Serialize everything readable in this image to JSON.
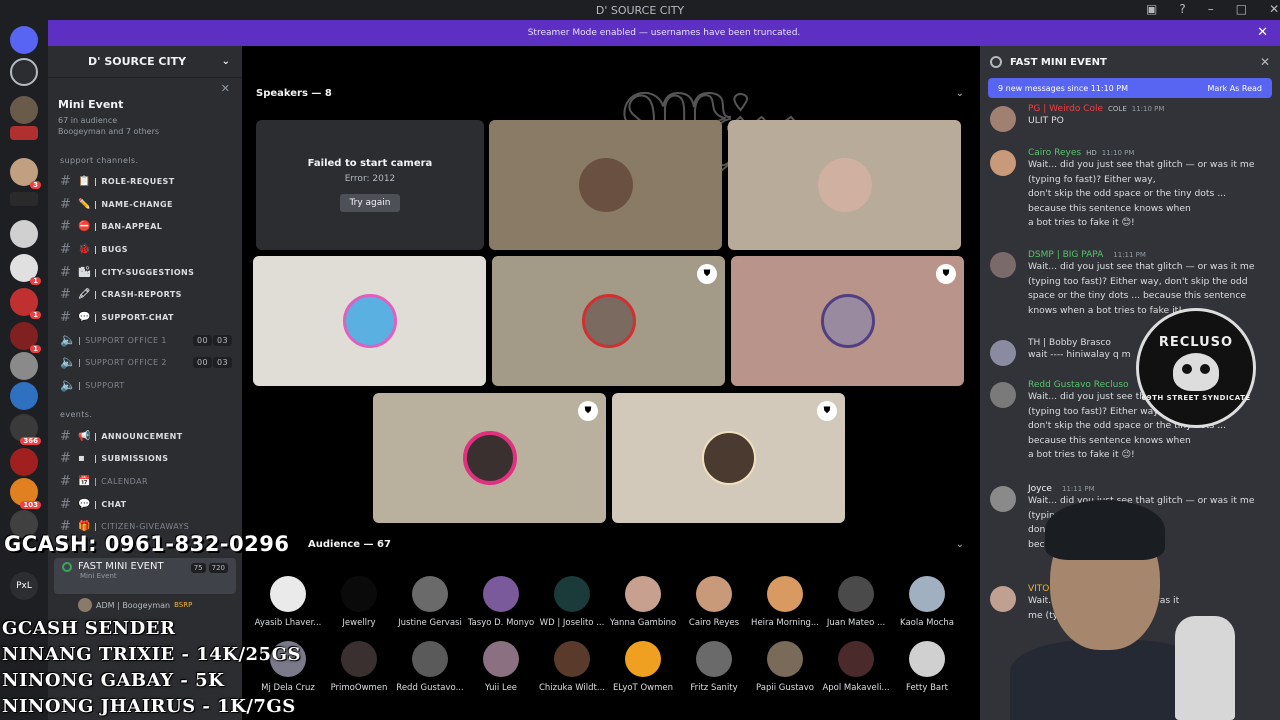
{
  "window": {
    "title": "D' SOURCE CITY"
  },
  "banner": {
    "text": "Streamer Mode enabled — usernames have been truncated."
  },
  "server": {
    "name": "D' SOURCE CITY"
  },
  "stage_card": {
    "title": "Mini Event",
    "audience": "67 in audience",
    "speakers": "Boogeyman and 7 others"
  },
  "categories": {
    "support": "support channels.",
    "events": "events."
  },
  "channels": [
    {
      "name": "ROLE-REQUEST",
      "emoji": "📋"
    },
    {
      "name": "NAME-CHANGE",
      "emoji": "✏️"
    },
    {
      "name": "BAN-APPEAL",
      "emoji": "⛔"
    },
    {
      "name": "BUGS",
      "emoji": "🐞"
    },
    {
      "name": "CITY-SUGGESTIONS",
      "emoji": "🏙"
    },
    {
      "name": "CRASH-REPORTS",
      "emoji": "🖍"
    },
    {
      "name": "SUPPORT-CHAT",
      "emoji": "💬"
    }
  ],
  "voice_channels": [
    {
      "name": "SUPPORT OFFICE 1",
      "c1": "00",
      "c2": "03"
    },
    {
      "name": "SUPPORT OFFICE 2",
      "c1": "00",
      "c2": "03"
    },
    {
      "name": "SUPPORT"
    }
  ],
  "event_channels": [
    {
      "name": "ANNOUNCEMENT",
      "emoji": "📢",
      "muted": false
    },
    {
      "name": "SUBMISSIONS",
      "emoji": "▪",
      "muted": false
    },
    {
      "name": "CALENDAR",
      "emoji": "📅",
      "muted": true
    },
    {
      "name": "CHAT",
      "emoji": "💬",
      "muted": false
    },
    {
      "name": "CITIZEN-GIVEAWAYS",
      "emoji": "🎁",
      "muted": true
    }
  ],
  "active_voice": {
    "name": "FAST MINI EVENT",
    "sub": "Mini Event",
    "count1": "75",
    "count2": "720",
    "user": "ADM | Boogeyman",
    "user_tag": "BSRP"
  },
  "stage": {
    "speakers_label": "Speakers — 8",
    "audience_label": "Audience — 67",
    "camera_error": "Failed to start camera",
    "error_code": "Error: 2012",
    "try_again": "Try again"
  },
  "audience": [
    {
      "name": "Ayasib Lhaver...",
      "color": "#eaeaea"
    },
    {
      "name": "Jewellry",
      "color": "#0a0a0a"
    },
    {
      "name": "Justine Gervasi",
      "color": "#6a6a6a"
    },
    {
      "name": "Tasyo D. Monyo",
      "color": "#7a5a9a"
    },
    {
      "name": "WD | Joselito ...",
      "color": "#1b3a3a"
    },
    {
      "name": "Yanna Gambino",
      "color": "#c8a090"
    },
    {
      "name": "Cairo Reyes",
      "color": "#c89a7a"
    },
    {
      "name": "Heira Morning...",
      "color": "#d89a60"
    },
    {
      "name": "Juan Mateo ...",
      "color": "#4a4a4a"
    },
    {
      "name": "Kaola Mocha",
      "color": "#a0b0c0"
    },
    {
      "name": "Mj Dela Cruz",
      "color": "#7a7a8a"
    },
    {
      "name": "PrimoOwmen",
      "color": "#3a3030"
    },
    {
      "name": "Redd Gustavo...",
      "color": "#5a5a5a"
    },
    {
      "name": "Yuii Lee",
      "color": "#8a7080"
    },
    {
      "name": "Chizuka Wildt...",
      "color": "#5a3a2a"
    },
    {
      "name": "ELyoT Owmen",
      "color": "#f0a020"
    },
    {
      "name": "Fritz Sanity",
      "color": "#6a6a6a"
    },
    {
      "name": "Papii Gustavo",
      "color": "#7a6a5a"
    },
    {
      "name": "Apol Makaveli...",
      "color": "#4a2a2a"
    },
    {
      "name": "Fetty Bart",
      "color": "#d0d0d0"
    }
  ],
  "chat": {
    "title": "FAST MINI EVENT",
    "new_messages": "9 new messages since 11:10 PM",
    "mark_read": "Mark As Read"
  },
  "messages": [
    {
      "author": "PG | Weirdo Cole",
      "tag": "COLE",
      "time": "11:10 PM",
      "color": "#f23f43",
      "body": "ULIT PO",
      "avatar": "#a08070"
    },
    {
      "author": "Cairo Reyes",
      "tag": "HD",
      "time": "11:10 PM",
      "color": "#57c36b",
      "body": "Wait... did you just see that glitch — or was it me\n(typing fo fast)? Either way,\ndon't skip the odd space or the tiny dots ...\nbecause this sentence knows when\na bot tries to fake it 😊!",
      "avatar": "#c89a7a"
    },
    {
      "author": "DSMP | BIG PAPA",
      "tag": "",
      "time": "11:11 PM",
      "color": "#57c36b",
      "body": "Wait... did you just see that glitch — or was it me\n(typing too fast)? Either way, don't skip the odd\nspace or the tiny dots ... because this sentence\nknows when a bot tries to fake it!",
      "avatar": "#7a6a6a"
    },
    {
      "author": "TH | Bobby Brasco",
      "tag": "",
      "time": "",
      "color": "#dbdee1",
      "body": "wait ---- hiniwalay q m",
      "avatar": "#8a8aa0"
    },
    {
      "author": "Redd Gustavo Recluso",
      "tag": "",
      "time": "",
      "color": "#57c36b",
      "body": "Wait... did you just see th\n(typing too fast)? Either way\ndon't skip the odd space or the tiny dots ...\nbecause this sentence knows when\na bot tries to fake it 😉!",
      "avatar": "#7a7a7a"
    },
    {
      "author": "Joyce",
      "tag": "",
      "time": "11:11 PM",
      "color": "#f2f3f5",
      "body": "Wait... did you just see that glitch — or was it me\n(typing\ndon't                    the tiny dots ...\nbec                      ws when",
      "avatar": "#8a8a8a"
    },
    {
      "author": "VITO",
      "tag": "",
      "time": "",
      "color": "#f0b232",
      "body": "Wait... did            that glitch --- or was it\nme (ty               way, don't skip the",
      "avatar": "#c0a090"
    }
  ],
  "overlay": {
    "gcash": "GCASH: 0961-832-0296",
    "lines": [
      "GCASH SENDER",
      "NINANG TRIXIE - 14K/25GS",
      "NINONG GABAY - 5K",
      "NINONG JHAIRUS - 1K/7GS"
    ],
    "logo_top": "RECLUSO",
    "logo_bottom": "69TH STREET SYNDICATE"
  }
}
